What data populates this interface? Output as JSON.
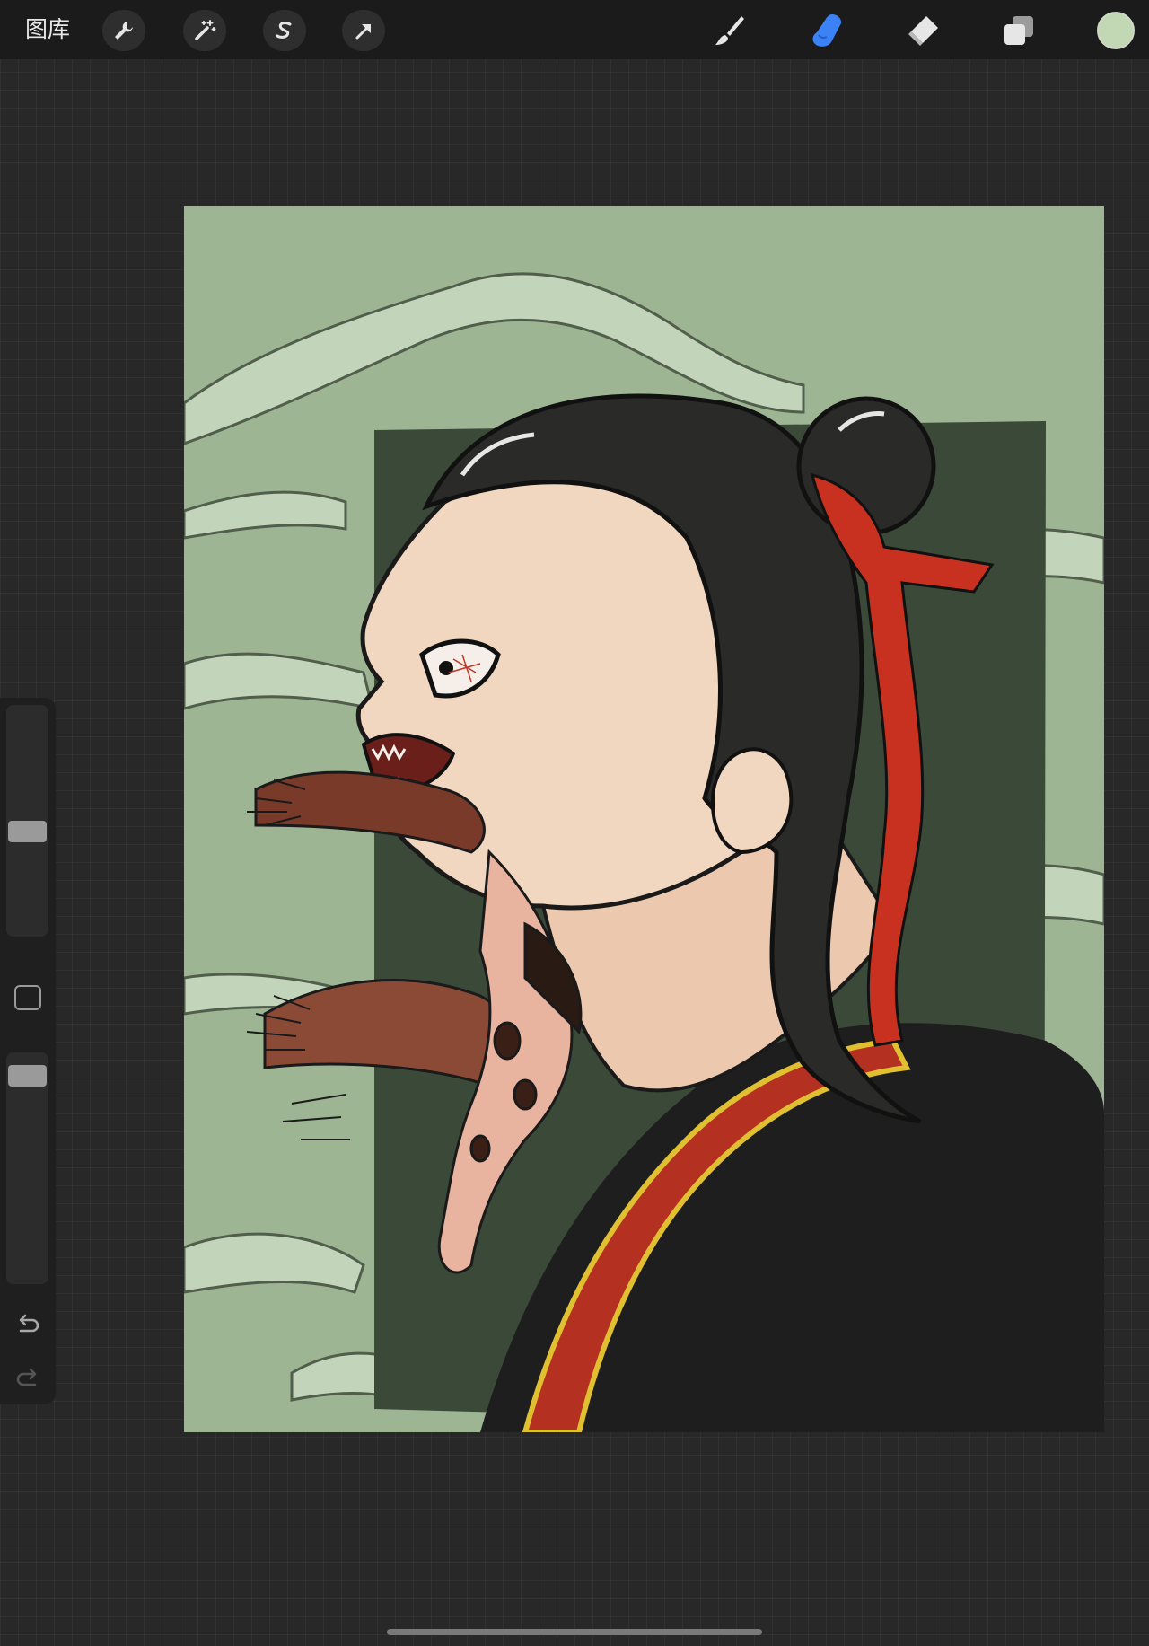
{
  "toolbar": {
    "gallery_label": "图库",
    "actions": [
      {
        "name": "actions-wrench",
        "icon": "wrench-icon"
      },
      {
        "name": "adjustments-wand",
        "icon": "magic-wand-icon"
      },
      {
        "name": "selection",
        "icon": "selection-s-icon"
      },
      {
        "name": "transform",
        "icon": "transform-arrow-icon"
      }
    ],
    "tools": [
      {
        "name": "brush",
        "icon": "brush-icon",
        "active": false
      },
      {
        "name": "smudge",
        "icon": "smudge-finger-icon",
        "active": true
      },
      {
        "name": "eraser",
        "icon": "eraser-icon",
        "active": false
      },
      {
        "name": "layers",
        "icon": "layers-icon",
        "active": false
      }
    ],
    "current_color": "#c2d7b3"
  },
  "sidebar": {
    "brush_size_level": 0.45,
    "opacity_level": 0.05,
    "undo_icon": "undo-icon",
    "redo_icon": "redo-icon"
  },
  "colors": {
    "active_tool": "#3b82f6",
    "canvas_bg": "#9eb594",
    "hair": "#2a2a28",
    "ribbon": "#c8311f",
    "skin": "#f2d7c0",
    "robe": "#1e1e1e",
    "dark_panel": "#3b4a38"
  }
}
